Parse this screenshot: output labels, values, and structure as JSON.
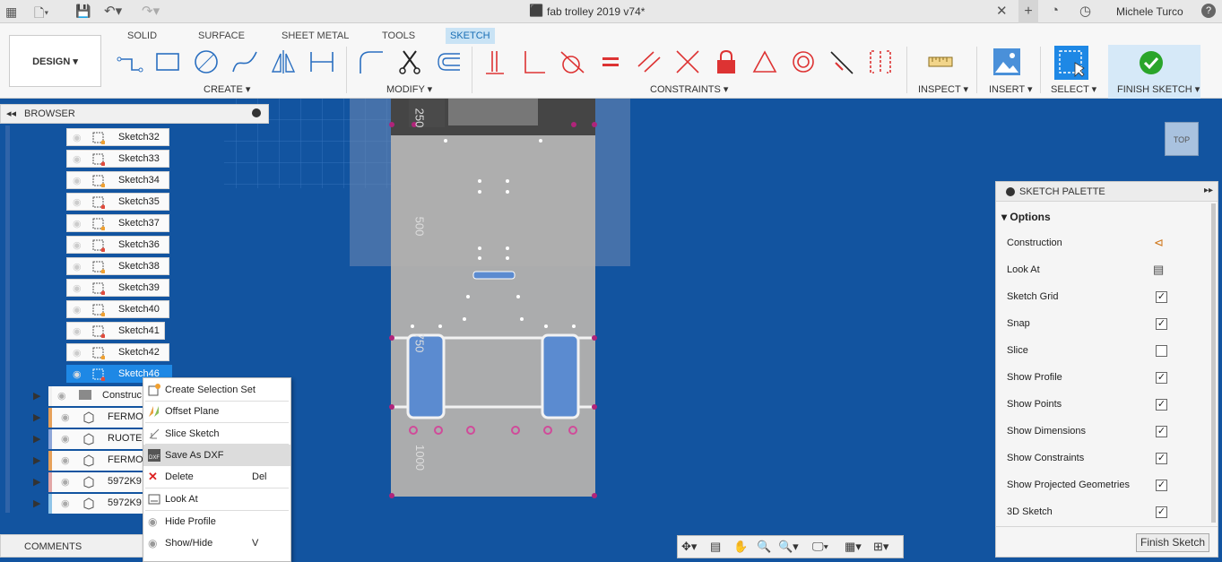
{
  "window": {
    "title": "fab trolley 2019 v74*",
    "user": "Michele Turco"
  },
  "workspace": {
    "label": "DESIGN"
  },
  "tabs": [
    "SOLID",
    "SURFACE",
    "SHEET METAL",
    "TOOLS",
    "SKETCH"
  ],
  "groups": {
    "create": "CREATE",
    "modify": "MODIFY",
    "constraints": "CONSTRAINTS",
    "inspect": "INSPECT",
    "insert": "INSERT",
    "select": "SELECT",
    "finish": "FINISH SKETCH"
  },
  "browser": {
    "title": "BROWSER",
    "sketches": [
      "Sketch32",
      "Sketch33",
      "Sketch34",
      "Sketch35",
      "Sketch37",
      "Sketch36",
      "Sketch38",
      "Sketch39",
      "Sketch40",
      "Sketch41",
      "Sketch42",
      "Sketch46"
    ],
    "components": [
      "Construc",
      "FERMO",
      "RUOTE",
      "FERMO",
      "5972K9",
      "5972K9"
    ]
  },
  "comments": {
    "label": "COMMENTS"
  },
  "context_menu": [
    {
      "label": "Create Selection Set",
      "shortcut": ""
    },
    {
      "label": "Offset Plane",
      "shortcut": ""
    },
    {
      "label": "Slice Sketch",
      "shortcut": ""
    },
    {
      "label": "Save As DXF",
      "shortcut": ""
    },
    {
      "label": "Delete",
      "shortcut": "Del"
    },
    {
      "label": "Look At",
      "shortcut": ""
    },
    {
      "label": "Hide Profile",
      "shortcut": ""
    },
    {
      "label": "Show/Hide",
      "shortcut": "V"
    }
  ],
  "palette": {
    "title": "SKETCH PALETTE",
    "section": "Options",
    "rows": [
      {
        "label": "Construction",
        "control": "icon"
      },
      {
        "label": "Look At",
        "control": "icon"
      },
      {
        "label": "Sketch Grid",
        "checked": true
      },
      {
        "label": "Snap",
        "checked": true
      },
      {
        "label": "Slice",
        "checked": false
      },
      {
        "label": "Show Profile",
        "checked": true
      },
      {
        "label": "Show Points",
        "checked": true
      },
      {
        "label": "Show Dimensions",
        "checked": true
      },
      {
        "label": "Show Constraints",
        "checked": true
      },
      {
        "label": "Show Projected Geometries",
        "checked": true
      },
      {
        "label": "3D Sketch",
        "checked": true
      }
    ],
    "finish_button": "Finish Sketch"
  },
  "viewcube": {
    "face": "TOP"
  },
  "dimensions": [
    "250",
    "500",
    "750",
    "1000"
  ],
  "colors": {
    "canvas": "#1254a0",
    "accent": "#1a6fb5",
    "finish": "#2aa52a"
  }
}
